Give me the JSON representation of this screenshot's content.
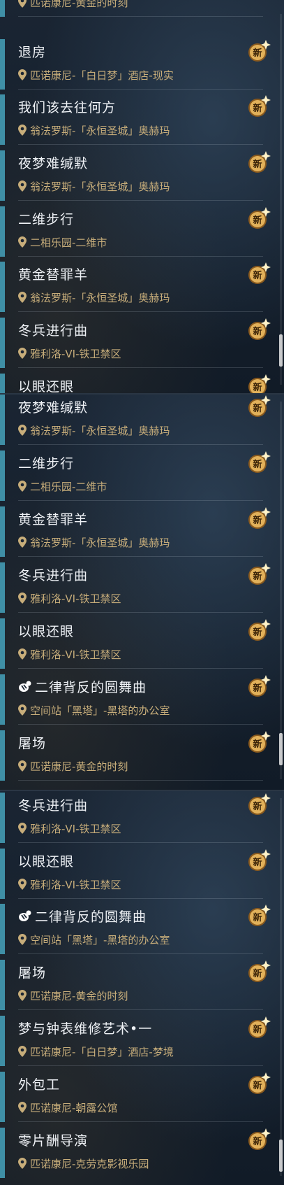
{
  "badge_label": "新",
  "panels": [
    {
      "entries": [
        {
          "title": "",
          "location": "匹诺康尼-黄金的时刻"
        },
        {
          "title": "退房",
          "location": "匹诺康尼-「白日梦」酒店-现实"
        },
        {
          "title": "我们该去往何方",
          "location": "翁法罗斯-「永恒圣城」奥赫玛"
        },
        {
          "title": "夜梦难缄默",
          "location": "翁法罗斯-「永恒圣城」奥赫玛"
        },
        {
          "title": "二维步行",
          "location": "二相乐园-二维市"
        },
        {
          "title": "黄金替罪羊",
          "location": "翁法罗斯-「永恒圣城」奥赫玛"
        },
        {
          "title": "冬兵进行曲",
          "location": "雅利洛-VI-铁卫禁区"
        },
        {
          "title": "以眼还眼",
          "location": ""
        }
      ]
    },
    {
      "entries": [
        {
          "title": "夜梦难缄默",
          "location": "翁法罗斯-「永恒圣城」奥赫玛"
        },
        {
          "title": "二维步行",
          "location": "二相乐园-二维市"
        },
        {
          "title": "黄金替罪羊",
          "location": "翁法罗斯-「永恒圣城」奥赫玛"
        },
        {
          "title": "冬兵进行曲",
          "location": "雅利洛-VI-铁卫禁区"
        },
        {
          "title": "以眼还眼",
          "location": "雅利洛-VI-铁卫禁区"
        },
        {
          "title": "二律背反的圆舞曲",
          "location": "空间站「黑塔」-黑塔的办公室",
          "icon": "mission-icon"
        },
        {
          "title": "屠场",
          "location": "匹诺康尼-黄金的时刻"
        }
      ]
    },
    {
      "entries": [
        {
          "title": "冬兵进行曲",
          "location": "雅利洛-VI-铁卫禁区"
        },
        {
          "title": "以眼还眼",
          "location": "雅利洛-VI-铁卫禁区"
        },
        {
          "title": "二律背反的圆舞曲",
          "location": "空间站「黑塔」-黑塔的办公室",
          "icon": "mission-icon"
        },
        {
          "title": "屠场",
          "location": "匹诺康尼-黄金的时刻"
        },
        {
          "title": "梦与钟表维修艺术•一",
          "location": "匹诺康尼-「白日梦」酒店-梦境"
        },
        {
          "title": "外包工",
          "location": "匹诺康尼-朝露公馆"
        },
        {
          "title": "零片酬导演",
          "location": "匹诺康尼-克劳克影视乐园"
        }
      ]
    }
  ]
}
